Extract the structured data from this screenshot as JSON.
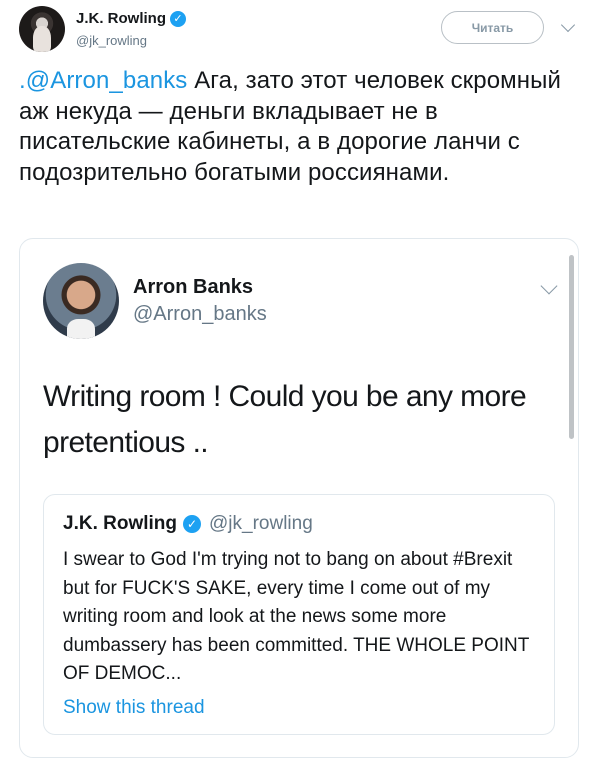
{
  "author": {
    "name": "J.K. Rowling",
    "handle": "@jk_rowling",
    "verified_mark": "✓"
  },
  "follow_button": {
    "label": "Читать"
  },
  "tweet": {
    "mention": ".@Arron_banks",
    "text": " Ага, зато этот человек скромный аж некуда — деньги вкладывает не в писательские кабинеты, а в дорогие ланчи с подозрительно богатыми россиянами."
  },
  "quoted_tweet": {
    "author_name": "Arron Banks",
    "author_handle": "@Arron_banks",
    "text": "Writing room ! Could you be any more pretentious ..",
    "inner_quote": {
      "author_name": "J.K. Rowling",
      "verified_mark": "✓",
      "author_handle": "@jk_rowling",
      "text": "I swear to God I'm trying not to bang on about #Brexit but for FUCK'S SAKE, every time I come out of my writing room and look at the news some more dumbassery has been committed. THE WHOLE POINT OF DEMOC...",
      "show_thread": "Show this thread"
    }
  },
  "colors": {
    "link": "#1b95e0",
    "verified": "#1da1f2",
    "muted": "#657786"
  },
  "icons": [
    "verified-badge-icon",
    "chevron-down-icon"
  ]
}
